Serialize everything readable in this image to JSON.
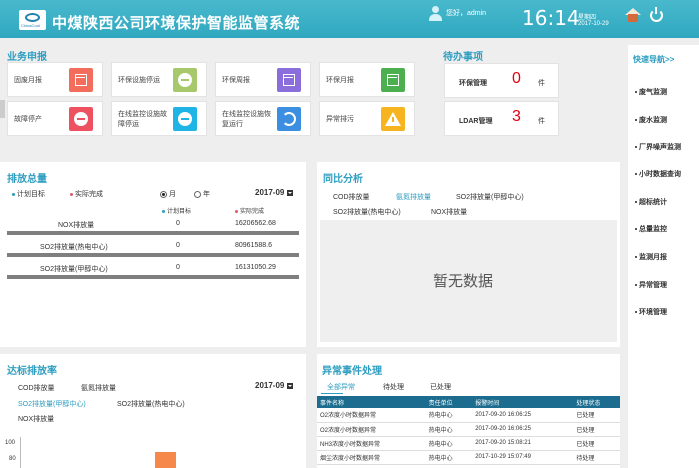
{
  "header": {
    "logo_text": "ChinaCoal",
    "title": "中煤陕西公司环境保护智能监管系统",
    "user": "您好，admin",
    "time": "16:14",
    "weekday": "星期四",
    "date": "2017-10-29"
  },
  "business": {
    "title": "业务申报",
    "tiles": [
      {
        "label": "固废月报",
        "icon": "calendar-icon",
        "color": "#f26d5b"
      },
      {
        "label": "环保设施停运",
        "icon": "minus-circle-icon",
        "color": "#a7c96b"
      },
      {
        "label": "环保周报",
        "icon": "calendar-icon",
        "color": "#8b6ddb"
      },
      {
        "label": "环保月报",
        "icon": "calendar-icon",
        "color": "#4cb050"
      },
      {
        "label": "故障停产",
        "icon": "minus-circle-icon",
        "color": "#ee5261"
      },
      {
        "label": "在线监控设施故障停运",
        "icon": "minus-circle-icon",
        "color": "#1fb4e6"
      },
      {
        "label": "在线监控设施恢复运行",
        "icon": "sync-icon",
        "color": "#3c8fe0"
      },
      {
        "label": "异常排污",
        "icon": "warning-icon",
        "color": "#f6b51f"
      }
    ]
  },
  "todo": {
    "title": "待办事项",
    "items": [
      {
        "label": "环保管理",
        "count": "0",
        "unit": "件"
      },
      {
        "label": "LDAR管理",
        "count": "3",
        "unit": "件"
      }
    ]
  },
  "rightnav": {
    "title": "快速导航>>",
    "items": [
      "废气监测",
      "废水监测",
      "厂界噪声监测",
      "小时数据查询",
      "超标统计",
      "总量监控",
      "监测月报",
      "异常管理",
      "环境管理"
    ]
  },
  "emission": {
    "title": "排放总量",
    "legend_plan": "计划目标",
    "legend_actual": "实际完成",
    "radio_month": "月",
    "radio_year": "年",
    "period": "2017-09",
    "col_plan": "计划目标",
    "col_actual": "实际完成",
    "rows": [
      {
        "name": "NOX排放量",
        "plan": "0",
        "actual": "16206562.68"
      },
      {
        "name": "SO2排放量(热电中心)",
        "plan": "0",
        "actual": "80961588.6"
      },
      {
        "name": "SO2排放量(甲醇中心)",
        "plan": "0",
        "actual": "16131050.29"
      }
    ]
  },
  "compare": {
    "title": "同比分析",
    "tabs": [
      "COD排放量",
      "氨氮排放量",
      "SO2排放量(甲醇中心)",
      "SO2排放量(热电中心)",
      "NOX排放量"
    ],
    "active_tab": 1,
    "empty": "暂无数据"
  },
  "rate": {
    "title": "达标排放率",
    "tabs": [
      "COD排放量",
      "氨氮排放量",
      "SO2排放量(甲醇中心)",
      "SO2排放量(热电中心)",
      "NOX排放量"
    ],
    "period": "2017-09",
    "ticks": [
      "100",
      "80"
    ],
    "chart_data": {
      "type": "bar",
      "categories": [
        ""
      ],
      "values": [
        82
      ],
      "ylim": [
        0,
        100
      ]
    }
  },
  "events": {
    "title": "异常事件处理",
    "tabs": [
      "全部异常",
      "待处理",
      "已处理"
    ],
    "columns": [
      "事件名称",
      "责任单位",
      "报警时间",
      "处理状态"
    ],
    "rows": [
      [
        "O2浓度小时数据异常",
        "热电中心",
        "2017-09-20 16:06:25",
        "已处理"
      ],
      [
        "O2浓度小时数据异常",
        "热电中心",
        "2017-09-20 16:06:25",
        "已处理"
      ],
      [
        "NH3浓度小时数据异常",
        "热电中心",
        "2017-09-20 15:08:21",
        "已处理"
      ],
      [
        "烟尘浓度小时数据异常",
        "热电中心",
        "2017-10-29 15:07:49",
        "待处理"
      ]
    ]
  }
}
